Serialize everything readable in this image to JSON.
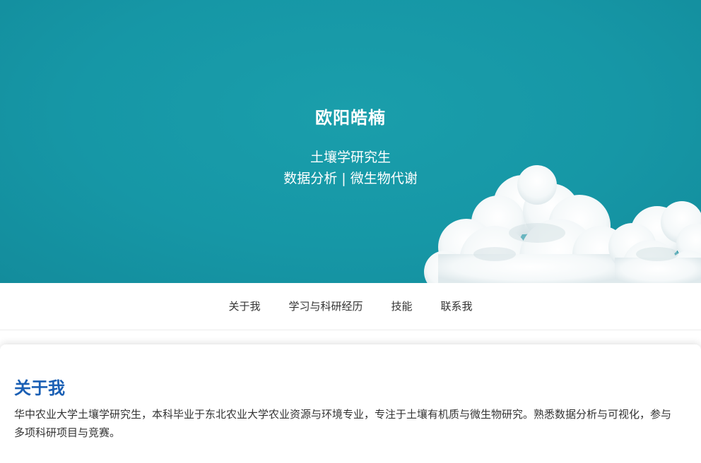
{
  "hero": {
    "name": "欧阳皓楠",
    "line1": "土壤学研究生",
    "line2": "数据分析 | 微生物代谢",
    "background_color": "#1697a6"
  },
  "nav": {
    "items": [
      {
        "label": "关于我"
      },
      {
        "label": "学习与科研经历"
      },
      {
        "label": "技能"
      },
      {
        "label": "联系我"
      }
    ]
  },
  "about": {
    "title": "关于我",
    "body": "华中农业大学土壤学研究生，本科毕业于东北农业大学农业资源与环境专业，专注于土壤有机质与微生物研究。熟悉数据分析与可视化，参与多项科研项目与竞赛。",
    "title_color": "#1a5fb4"
  }
}
